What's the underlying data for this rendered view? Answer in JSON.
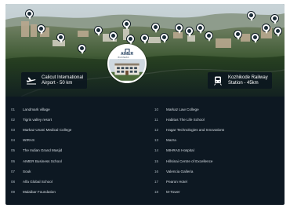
{
  "colors": {
    "background": "#0d1822",
    "text": "#d6dde3",
    "pin_fill": "#ffffff"
  },
  "map": {
    "icons": {
      "pin": "map-pin-icon",
      "airport": "airplane-icon",
      "rail": "train-icon"
    },
    "center_logo": {
      "brand": "AIMER",
      "tagline": "BUSINESS SCHOOL"
    },
    "airport_chip": {
      "line1": "Calicut International",
      "line2": "Airport - 50 km"
    },
    "rail_chip": {
      "line1": "Kozhikode Railway",
      "line2": "Station - 45km"
    }
  },
  "landmarks": {
    "left": [
      {
        "num": "01",
        "name": "Landmark village"
      },
      {
        "num": "02",
        "name": "Tigris valley resort"
      },
      {
        "num": "03",
        "name": "Markaz Unani Medical College"
      },
      {
        "num": "04",
        "name": "WIRAS"
      },
      {
        "num": "05",
        "name": "The Indian Grand Masjid"
      },
      {
        "num": "06",
        "name": "AIMER Business School"
      },
      {
        "num": "07",
        "name": "Souk"
      },
      {
        "num": "08",
        "name": "Alfa Global School"
      },
      {
        "num": "09",
        "name": "Malaibar Foundation"
      }
    ],
    "right": [
      {
        "num": "10",
        "name": "Markaz Law College"
      },
      {
        "num": "11",
        "name": "Habitus The Life School"
      },
      {
        "num": "12",
        "name": "Hagar Technologies and Innovations"
      },
      {
        "num": "13",
        "name": "Mazra"
      },
      {
        "num": "14",
        "name": "MIHRAS Hospital"
      },
      {
        "num": "15",
        "name": "Hillsinai Centre of Excellence"
      },
      {
        "num": "16",
        "name": "Valencia Galleria"
      },
      {
        "num": "17",
        "name": "Pearon Hotel"
      },
      {
        "num": "18",
        "name": "M-Tower"
      }
    ]
  }
}
